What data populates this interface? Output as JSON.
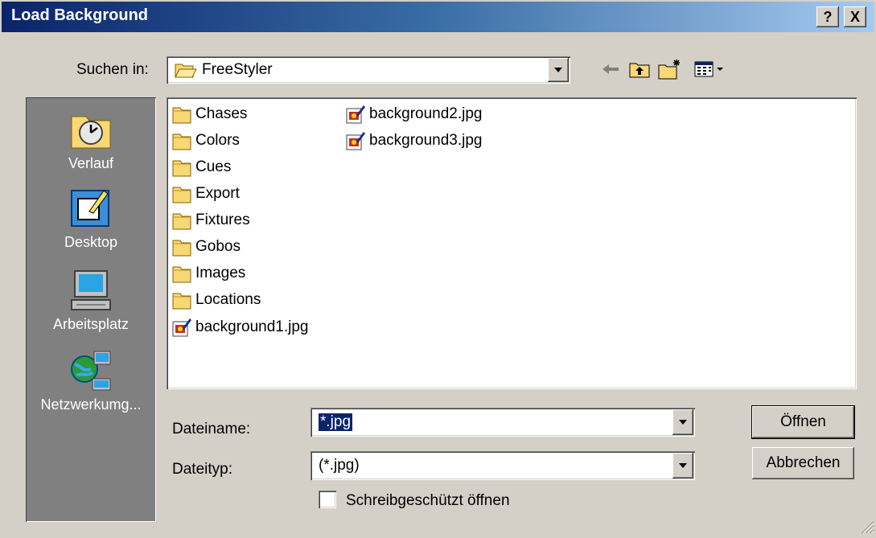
{
  "window": {
    "title": "Load Background",
    "help_label": "?",
    "close_label": "X"
  },
  "lookin": {
    "label": "Suchen in:",
    "value": "FreeStyler"
  },
  "toolbar": {
    "back": "back-arrow-icon",
    "up": "up-folder-icon",
    "newfolder": "new-folder-icon",
    "view": "view-menu-icon"
  },
  "places": [
    {
      "label": "Verlauf",
      "icon": "history-icon"
    },
    {
      "label": "Desktop",
      "icon": "desktop-icon"
    },
    {
      "label": "Arbeitsplatz",
      "icon": "my-computer-icon"
    },
    {
      "label": "Netzwerkumg...",
      "icon": "network-icon"
    }
  ],
  "files": [
    {
      "name": "Chases",
      "type": "folder"
    },
    {
      "name": "Colors",
      "type": "folder"
    },
    {
      "name": "Cues",
      "type": "folder"
    },
    {
      "name": "Export",
      "type": "folder"
    },
    {
      "name": "Fixtures",
      "type": "folder"
    },
    {
      "name": "Gobos",
      "type": "folder"
    },
    {
      "name": "Images",
      "type": "folder"
    },
    {
      "name": "Locations",
      "type": "folder"
    },
    {
      "name": "background1.jpg",
      "type": "image"
    },
    {
      "name": "background2.jpg",
      "type": "image"
    },
    {
      "name": "background3.jpg",
      "type": "image"
    }
  ],
  "filename": {
    "label": "Dateiname:",
    "value": "*.jpg"
  },
  "filetype": {
    "label": "Dateityp:",
    "value": "(*.jpg)"
  },
  "readonly": {
    "label": "Schreibgeschützt öffnen",
    "checked": false
  },
  "buttons": {
    "open": "Öffnen",
    "cancel": "Abbrechen"
  },
  "colors": {
    "titlebar_start": "#0a246a",
    "titlebar_end": "#a6caf0",
    "face": "#d4d0c8",
    "selection": "#0a246a"
  }
}
